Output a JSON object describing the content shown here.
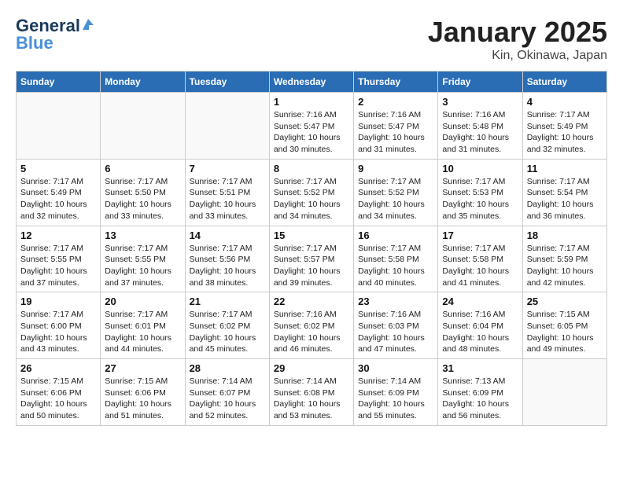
{
  "header": {
    "logo_line1": "General",
    "logo_line2": "Blue",
    "title": "January 2025",
    "subtitle": "Kin, Okinawa, Japan"
  },
  "weekdays": [
    "Sunday",
    "Monday",
    "Tuesday",
    "Wednesday",
    "Thursday",
    "Friday",
    "Saturday"
  ],
  "weeks": [
    [
      {
        "day": "",
        "info": ""
      },
      {
        "day": "",
        "info": ""
      },
      {
        "day": "",
        "info": ""
      },
      {
        "day": "1",
        "info": "Sunrise: 7:16 AM\nSunset: 5:47 PM\nDaylight: 10 hours\nand 30 minutes."
      },
      {
        "day": "2",
        "info": "Sunrise: 7:16 AM\nSunset: 5:47 PM\nDaylight: 10 hours\nand 31 minutes."
      },
      {
        "day": "3",
        "info": "Sunrise: 7:16 AM\nSunset: 5:48 PM\nDaylight: 10 hours\nand 31 minutes."
      },
      {
        "day": "4",
        "info": "Sunrise: 7:17 AM\nSunset: 5:49 PM\nDaylight: 10 hours\nand 32 minutes."
      }
    ],
    [
      {
        "day": "5",
        "info": "Sunrise: 7:17 AM\nSunset: 5:49 PM\nDaylight: 10 hours\nand 32 minutes."
      },
      {
        "day": "6",
        "info": "Sunrise: 7:17 AM\nSunset: 5:50 PM\nDaylight: 10 hours\nand 33 minutes."
      },
      {
        "day": "7",
        "info": "Sunrise: 7:17 AM\nSunset: 5:51 PM\nDaylight: 10 hours\nand 33 minutes."
      },
      {
        "day": "8",
        "info": "Sunrise: 7:17 AM\nSunset: 5:52 PM\nDaylight: 10 hours\nand 34 minutes."
      },
      {
        "day": "9",
        "info": "Sunrise: 7:17 AM\nSunset: 5:52 PM\nDaylight: 10 hours\nand 34 minutes."
      },
      {
        "day": "10",
        "info": "Sunrise: 7:17 AM\nSunset: 5:53 PM\nDaylight: 10 hours\nand 35 minutes."
      },
      {
        "day": "11",
        "info": "Sunrise: 7:17 AM\nSunset: 5:54 PM\nDaylight: 10 hours\nand 36 minutes."
      }
    ],
    [
      {
        "day": "12",
        "info": "Sunrise: 7:17 AM\nSunset: 5:55 PM\nDaylight: 10 hours\nand 37 minutes."
      },
      {
        "day": "13",
        "info": "Sunrise: 7:17 AM\nSunset: 5:55 PM\nDaylight: 10 hours\nand 37 minutes."
      },
      {
        "day": "14",
        "info": "Sunrise: 7:17 AM\nSunset: 5:56 PM\nDaylight: 10 hours\nand 38 minutes."
      },
      {
        "day": "15",
        "info": "Sunrise: 7:17 AM\nSunset: 5:57 PM\nDaylight: 10 hours\nand 39 minutes."
      },
      {
        "day": "16",
        "info": "Sunrise: 7:17 AM\nSunset: 5:58 PM\nDaylight: 10 hours\nand 40 minutes."
      },
      {
        "day": "17",
        "info": "Sunrise: 7:17 AM\nSunset: 5:58 PM\nDaylight: 10 hours\nand 41 minutes."
      },
      {
        "day": "18",
        "info": "Sunrise: 7:17 AM\nSunset: 5:59 PM\nDaylight: 10 hours\nand 42 minutes."
      }
    ],
    [
      {
        "day": "19",
        "info": "Sunrise: 7:17 AM\nSunset: 6:00 PM\nDaylight: 10 hours\nand 43 minutes."
      },
      {
        "day": "20",
        "info": "Sunrise: 7:17 AM\nSunset: 6:01 PM\nDaylight: 10 hours\nand 44 minutes."
      },
      {
        "day": "21",
        "info": "Sunrise: 7:17 AM\nSunset: 6:02 PM\nDaylight: 10 hours\nand 45 minutes."
      },
      {
        "day": "22",
        "info": "Sunrise: 7:16 AM\nSunset: 6:02 PM\nDaylight: 10 hours\nand 46 minutes."
      },
      {
        "day": "23",
        "info": "Sunrise: 7:16 AM\nSunset: 6:03 PM\nDaylight: 10 hours\nand 47 minutes."
      },
      {
        "day": "24",
        "info": "Sunrise: 7:16 AM\nSunset: 6:04 PM\nDaylight: 10 hours\nand 48 minutes."
      },
      {
        "day": "25",
        "info": "Sunrise: 7:15 AM\nSunset: 6:05 PM\nDaylight: 10 hours\nand 49 minutes."
      }
    ],
    [
      {
        "day": "26",
        "info": "Sunrise: 7:15 AM\nSunset: 6:06 PM\nDaylight: 10 hours\nand 50 minutes."
      },
      {
        "day": "27",
        "info": "Sunrise: 7:15 AM\nSunset: 6:06 PM\nDaylight: 10 hours\nand 51 minutes."
      },
      {
        "day": "28",
        "info": "Sunrise: 7:14 AM\nSunset: 6:07 PM\nDaylight: 10 hours\nand 52 minutes."
      },
      {
        "day": "29",
        "info": "Sunrise: 7:14 AM\nSunset: 6:08 PM\nDaylight: 10 hours\nand 53 minutes."
      },
      {
        "day": "30",
        "info": "Sunrise: 7:14 AM\nSunset: 6:09 PM\nDaylight: 10 hours\nand 55 minutes."
      },
      {
        "day": "31",
        "info": "Sunrise: 7:13 AM\nSunset: 6:09 PM\nDaylight: 10 hours\nand 56 minutes."
      },
      {
        "day": "",
        "info": ""
      }
    ]
  ]
}
